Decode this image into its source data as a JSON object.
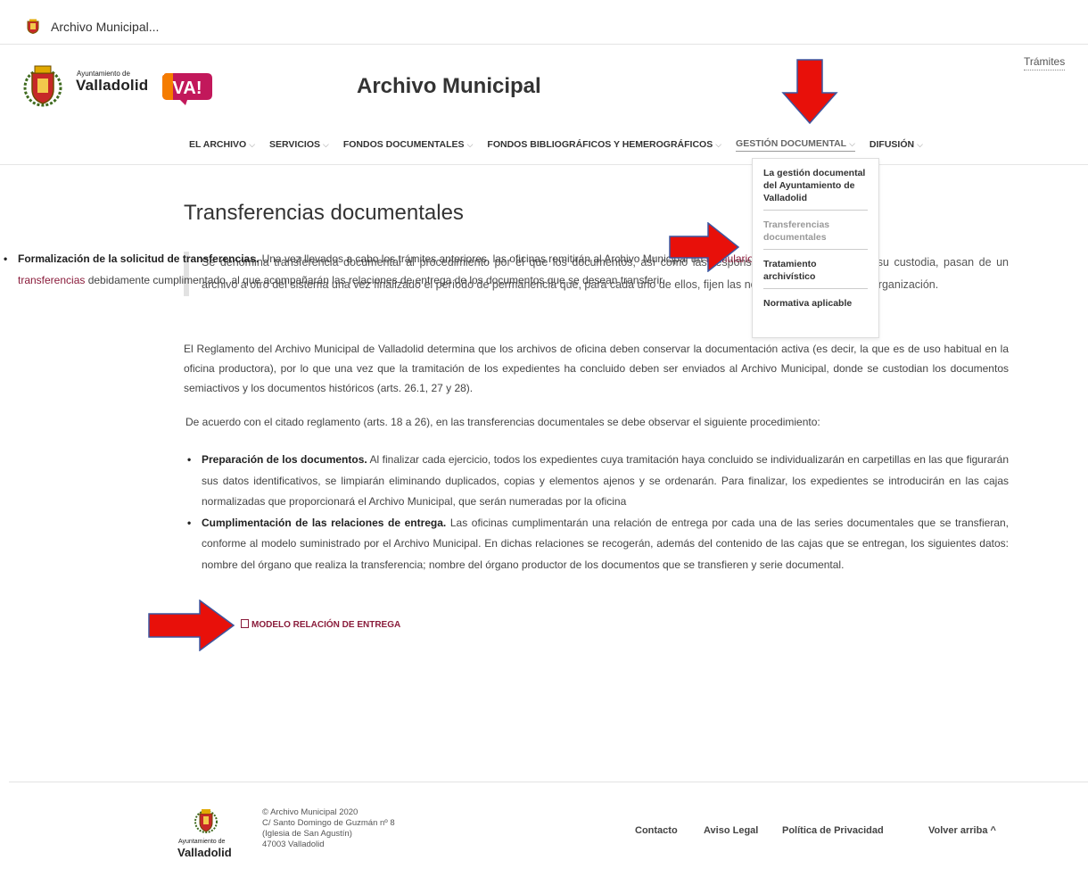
{
  "browser": {
    "tab_title": "Archivo Municipal..."
  },
  "header": {
    "logo_small": "Ayuntamiento de",
    "logo_big": "Valladolid",
    "va_logo": "VA!",
    "site_title": "Archivo Municipal",
    "tramites": "Trámites"
  },
  "nav": {
    "items": [
      {
        "label": "EL ARCHIVO"
      },
      {
        "label": "SERVICIOS"
      },
      {
        "label": "FONDOS DOCUMENTALES"
      },
      {
        "label": "FONDOS BIBLIOGRÁFICOS Y HEMEROGRÁFICOS"
      },
      {
        "label": "GESTIÓN DOCUMENTAL"
      },
      {
        "label": "DIFUSIÓN"
      }
    ],
    "chevron": "⌵"
  },
  "dropdown": {
    "items": [
      {
        "label": "La gestión documental del Ayuntamiento de Valladolid"
      },
      {
        "label": "Transferencias documentales"
      },
      {
        "label": "Tratamiento archivístico"
      },
      {
        "label": "Normativa aplicable"
      }
    ]
  },
  "main": {
    "title": "Transferencias documentales",
    "quote": "Se denomina transferencia documental al procedimiento por el que los documentos, así como las responsabilidades derivadas de su custodia, pasan de un archivo a otro del sistema una vez finalizado el período de permanencia que, para cada uno de ellos, fijen las normas vigentes en cada organización.",
    "p1": "El Reglamento del Archivo Municipal de Valladolid determina que los archivos de oficina deben conservar la documentación activa (es decir, la que es de uso habitual en la oficina productora), por lo que una vez que la tramitación de los expedientes ha concluido deben ser enviados al Archivo Municipal, donde  se custodian los documentos semiactivos y los documentos históricos (arts. 26.1, 27 y 28).",
    "p2": "De acuerdo con el citado reglamento (arts. 18 a 26), en las transferencias documentales se debe observar el siguiente procedimiento:",
    "step1_bold": "Preparación de los documentos.",
    "step1_text": " Al finalizar cada ejercicio, todos los expedientes cuya tramitación haya concluido se individualizarán en carpetillas en las que figurarán sus datos identificativos, se limpiarán eliminando duplicados, copias y elementos ajenos y se ordenarán. Para finalizar, los expedientes se introducirán en las cajas normalizadas que proporcionará el Archivo Municipal, que serán numeradas por la oficina",
    "step2_bold": "Cumplimentación de las relaciones de entrega.",
    "step2_text": " Las oficinas cumplimentarán una relación de entrega por cada una de las series documentales que se transfieran, conforme al modelo suministrado por el Archivo Municipal. En dichas relaciones se recogerán, además del contenido de las cajas que se entregan, los siguientes datos: nombre del órgano que realiza la transferencia; nombre del órgano productor de los documentos que se transfieren y serie documental.",
    "modelo_link": "MODELO RELACIÓN DE ENTREGA",
    "step3_bold": "Formalización de la solicitud de transferencias.",
    "step3_pre": " Una vez llevados a cabo los trámites anteriores, las oficinas remitirán al Archivo Municipal un ",
    "step3_link": "formulario de solicitud de transferencias",
    "step3_post": " debidamente cumplimentado, al que acompañarán las relaciones de entrega de los documentos que se desean transferir."
  },
  "footer": {
    "logo_small": "Ayuntamiento de",
    "logo_big": "Valladolid",
    "address": [
      "© Archivo Municipal 2020",
      "C/ Santo Domingo de Guzmán nº 8",
      "(Iglesia de San Agustín)",
      "47003 Valladolid"
    ],
    "contacto": "Contacto",
    "aviso": "Aviso Legal",
    "privacidad": "Política de Privacidad",
    "volver": "Volver arriba",
    "volver_icon": "^"
  },
  "colors": {
    "link": "#8a1c3b",
    "arrow": "#e8100a",
    "va_logo": "#c2185b"
  }
}
